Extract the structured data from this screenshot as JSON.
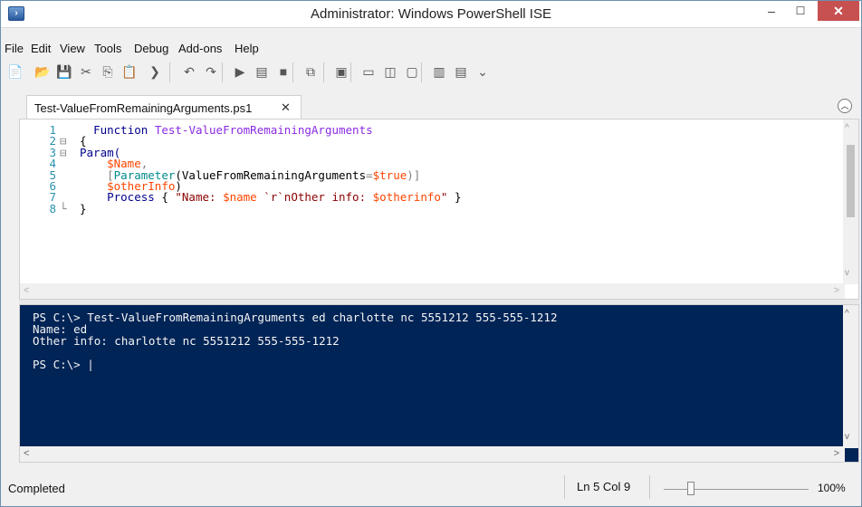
{
  "window": {
    "title": "Administrator: Windows PowerShell ISE",
    "minimize": "–",
    "maximize": "☐",
    "close": "✕",
    "app_icon": "›"
  },
  "menu": [
    "File",
    "Edit",
    "View",
    "Tools",
    "Debug",
    "Add-ons",
    "Help"
  ],
  "toolbar_icons": [
    {
      "name": "new-script-icon",
      "glyph": "📄"
    },
    {
      "name": "open-icon",
      "glyph": "📂"
    },
    {
      "name": "save-icon",
      "glyph": "💾"
    },
    {
      "name": "cut-icon",
      "glyph": "✂"
    },
    {
      "name": "copy-icon",
      "glyph": "⎘"
    },
    {
      "name": "paste-icon",
      "glyph": "📋"
    },
    {
      "name": "clear-console-icon",
      "glyph": "❯"
    },
    {
      "name": "undo-icon",
      "glyph": "↶"
    },
    {
      "name": "redo-icon",
      "glyph": "↷"
    },
    {
      "name": "run-script-icon",
      "glyph": "▶"
    },
    {
      "name": "run-selection-icon",
      "glyph": "▤"
    },
    {
      "name": "stop-icon",
      "glyph": "■"
    },
    {
      "name": "remote-powershell-icon",
      "glyph": "⧉"
    },
    {
      "name": "start-powershell-icon",
      "glyph": "▣"
    },
    {
      "name": "show-script-top-icon",
      "glyph": "▭"
    },
    {
      "name": "show-script-right-icon",
      "glyph": "◫"
    },
    {
      "name": "show-script-maximized-icon",
      "glyph": "▢"
    },
    {
      "name": "show-script-pane-icon",
      "glyph": "▥"
    },
    {
      "name": "show-command-addon-icon",
      "glyph": "▤"
    },
    {
      "name": "toolbar-overflow-icon",
      "glyph": "⌄"
    }
  ],
  "tab": {
    "label": "Test-ValueFromRemainingArguments.ps1",
    "close": "✕",
    "collapse": "︿"
  },
  "editor": {
    "line_numbers": [
      "1",
      "2",
      "3",
      "4",
      "5",
      "6",
      "7",
      "8"
    ],
    "gutter": [
      "",
      "⊟",
      "⊟",
      "",
      "",
      "",
      "",
      "└"
    ],
    "lines": [
      [
        {
          "t": "  ",
          "c": ""
        },
        {
          "t": "Function",
          "c": "kw"
        },
        {
          "t": " ",
          "c": ""
        },
        {
          "t": "Test-ValueFromRemainingArguments",
          "c": "fn"
        }
      ],
      [
        {
          "t": "{",
          "c": ""
        }
      ],
      [
        {
          "t": "Param(",
          "c": "kw"
        }
      ],
      [
        {
          "t": "    ",
          "c": ""
        },
        {
          "t": "$Name",
          "c": "var"
        },
        {
          "t": ",",
          "c": "op"
        }
      ],
      [
        {
          "t": "    ",
          "c": ""
        },
        {
          "t": "[",
          "c": "op"
        },
        {
          "t": "Parameter",
          "c": "type"
        },
        {
          "t": "(ValueFromRemainingArguments",
          "c": ""
        },
        {
          "t": "=",
          "c": "op"
        },
        {
          "t": "$true",
          "c": "var"
        },
        {
          "t": ")]",
          "c": "op"
        }
      ],
      [
        {
          "t": "    ",
          "c": ""
        },
        {
          "t": "$otherInfo",
          "c": "var"
        },
        {
          "t": ")",
          "c": ""
        }
      ],
      [
        {
          "t": "    ",
          "c": ""
        },
        {
          "t": "Process",
          "c": "kw"
        },
        {
          "t": " { ",
          "c": ""
        },
        {
          "t": "\"Name: ",
          "c": "str"
        },
        {
          "t": "$name",
          "c": "var"
        },
        {
          "t": " `r`nOther info: ",
          "c": "str"
        },
        {
          "t": "$otherinfo",
          "c": "var"
        },
        {
          "t": "\"",
          "c": "str"
        },
        {
          "t": " }",
          "c": ""
        }
      ],
      [
        {
          "t": "}",
          "c": ""
        }
      ]
    ]
  },
  "console": {
    "lines": [
      "PS C:\\> Test-ValueFromRemainingArguments ed charlotte nc 5551212 555-555-1212",
      "Name: ed",
      "Other info: charlotte nc 5551212 555-555-1212",
      "",
      "PS C:\\> |"
    ]
  },
  "status": {
    "text": "Completed",
    "position": "Ln 5  Col 9",
    "zoom": "100%"
  },
  "scroll_arrows": {
    "up": "^",
    "down": "v",
    "left": "<",
    "right": ">"
  }
}
